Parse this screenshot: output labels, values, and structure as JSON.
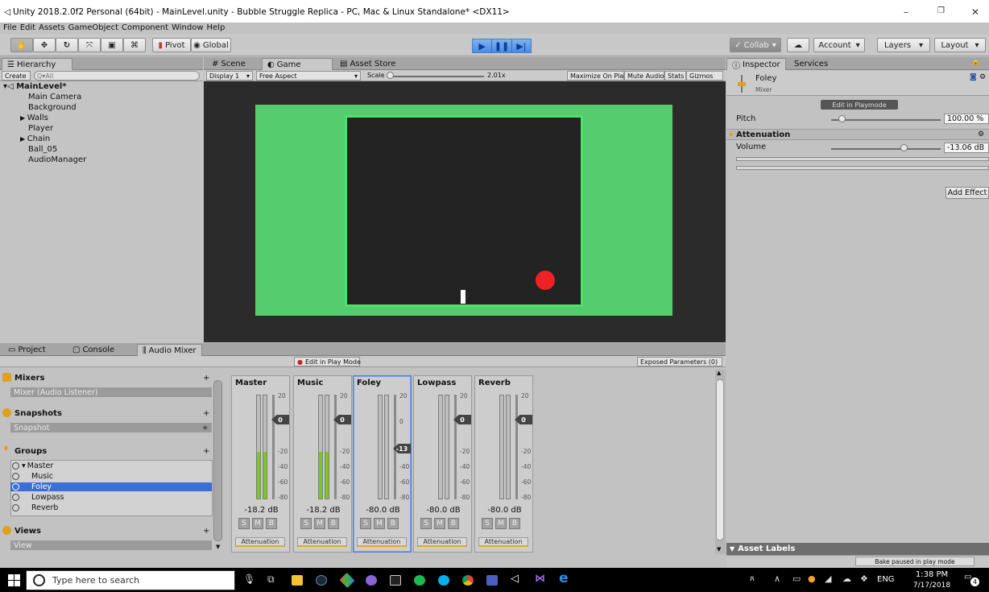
{
  "window": {
    "title": "Unity 2018.2.0f2 Personal (64bit) - MainLevel.unity - Bubble Struggle Replica - PC, Mac & Linux Standalone* <DX11>",
    "minimize": "–",
    "maximize": "❐",
    "close": "✕"
  },
  "menu": [
    "File",
    "Edit",
    "Assets",
    "GameObject",
    "Component",
    "Window",
    "Help"
  ],
  "toolbar": {
    "pivot": "Pivot",
    "global": "Global",
    "collab": "Collab",
    "account": "Account",
    "layers": "Layers",
    "layout": "Layout"
  },
  "hierarchy": {
    "tab": "Hierarchy",
    "create": "Create",
    "search_placeholder": "Q▾All",
    "scene": "MainLevel*",
    "items": [
      "Main Camera",
      "Background",
      "Walls",
      "Player",
      "Chain",
      "Ball_05",
      "AudioManager"
    ]
  },
  "center_tabs": {
    "scene": "Scene",
    "game": "Game",
    "asset_store": "Asset Store"
  },
  "game_bar": {
    "display": "Display 1",
    "aspect": "Free Aspect",
    "scale_label": "Scale",
    "scale_value": "2.01x",
    "maximize": "Maximize On Play",
    "mute": "Mute Audio",
    "stats": "Stats",
    "gizmos": "Gizmos"
  },
  "bottom_tabs": {
    "project": "Project",
    "console": "Console",
    "audio_mixer": "Audio Mixer"
  },
  "mixer_bar": {
    "edit_play": "Edit in Play Mode",
    "exposed": "Exposed Parameters (0)"
  },
  "mixer_sidebar": {
    "mixers": "Mixers",
    "mixer_item": "Mixer  (Audio Listener)",
    "snapshots": "Snapshots",
    "snapshot_item": "Snapshot",
    "groups": "Groups",
    "group_items": [
      "Master",
      "Music",
      "Foley",
      "Lowpass",
      "Reverb"
    ],
    "views": "Views",
    "view_item": "View"
  },
  "strips": [
    {
      "name": "Master",
      "db": "-18.2 dB",
      "level": 0.45,
      "knob": "0"
    },
    {
      "name": "Music",
      "db": "-18.2 dB",
      "level": 0.45,
      "knob": "0"
    },
    {
      "name": "Foley",
      "db": "-80.0 dB",
      "level": 0,
      "knob": "-13"
    },
    {
      "name": "Lowpass",
      "db": "-80.0 dB",
      "level": 0,
      "knob": "0"
    },
    {
      "name": "Reverb",
      "db": "-80.0 dB",
      "level": 0,
      "knob": "0"
    }
  ],
  "strip_labels": {
    "s": "S",
    "m": "M",
    "b": "B",
    "attenuation": "Attenuation",
    "ticks": [
      "20",
      "0",
      "-20",
      "-40",
      "-60",
      "-80"
    ]
  },
  "inspector": {
    "tab": "Inspector",
    "services": "Services",
    "name": "Foley",
    "sub": "Mixer",
    "edit_play": "Edit in Playmode",
    "pitch_label": "Pitch",
    "pitch_value": "100.00 %",
    "attenuation": "Attenuation",
    "volume_label": "Volume",
    "volume_value": "-13.06 dB",
    "add_effect": "Add Effect",
    "asset_labels": "Asset Labels",
    "bake": "Bake paused in play mode"
  },
  "taskbar": {
    "search": "Type here to search",
    "lang": "ENG",
    "time": "1:38 PM",
    "date": "7/17/2018",
    "notif": "4"
  },
  "colors": {
    "game_green": "#55cc6e",
    "game_dark": "#232323",
    "ball": "#ee2222",
    "meter_green": "#7ec81c",
    "selection": "#3b6fd6"
  }
}
